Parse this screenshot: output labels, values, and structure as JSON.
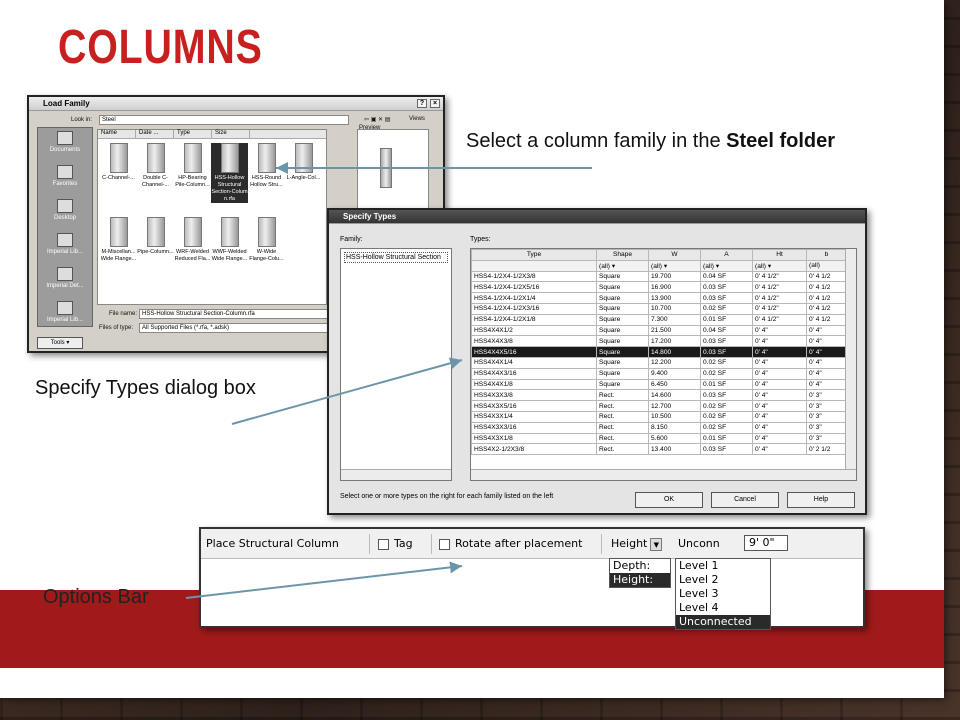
{
  "slide": {
    "title": "COLUMNS",
    "callout_steel_prefix": "Select a column family in the ",
    "callout_steel_bold": "Steel folder",
    "callout_specify": "Specify Types dialog box",
    "callout_options": "Options Bar",
    "accent_color": "#c8201e",
    "band_color": "#a11a1a"
  },
  "load_family": {
    "title": "Load Family",
    "look_in_label": "Look in:",
    "look_in_value": "Steel",
    "views_label": "Views",
    "preview_label": "Preview",
    "columns": [
      "Name",
      "Date ...",
      "Type",
      "Size"
    ],
    "places": [
      "Documents",
      "Favorites",
      "Desktop",
      "Imperial Lib...",
      "Imperial Det...",
      "Imperial Lib..."
    ],
    "files": [
      "C-Channel-...",
      "Double C-Channel-...",
      "HP-Bearing Pile-Column...",
      "HSS-Hollow Structural Section-Colum n.rfa",
      "HSS-Round Hollow Stru...",
      "L-Angle-Col...",
      "M-Miscellan... Wide Flange...",
      "Pipe-Column...",
      "WRF-Welded Reduced Fla...",
      "WWF-Welded Wide Flange...",
      "W-Wide Flange-Colu..."
    ],
    "file_name_label": "File name:",
    "file_name_value": "HSS-Hollow Structural Section-Column.rfa",
    "files_of_type_label": "Files of type:",
    "files_of_type_value": "All Supported Files (*.rfa, *.adsk)",
    "tools_label": "Tools"
  },
  "specify_types": {
    "title": "Specify Types",
    "family_label": "Family:",
    "types_label": "Types:",
    "family_item": "HSS-Hollow Structural Section",
    "headers": [
      "Type",
      "Shape",
      "W",
      "A",
      "Ht",
      "b"
    ],
    "filter_value": "(all)",
    "rows": [
      [
        "HSS4-1/2X4-1/2X3/8",
        "Square",
        "19.700",
        "0.04 SF",
        "0' 4 1/2\"",
        "0' 4 1/2"
      ],
      [
        "HSS4-1/2X4-1/2X5/16",
        "Square",
        "16.900",
        "0.03 SF",
        "0' 4 1/2\"",
        "0' 4 1/2"
      ],
      [
        "HSS4-1/2X4-1/2X1/4",
        "Square",
        "13.900",
        "0.03 SF",
        "0' 4 1/2\"",
        "0' 4 1/2"
      ],
      [
        "HSS4-1/2X4-1/2X3/16",
        "Square",
        "10.700",
        "0.02 SF",
        "0' 4 1/2\"",
        "0' 4 1/2"
      ],
      [
        "HSS4-1/2X4-1/2X1/8",
        "Square",
        "7.300",
        "0.01 SF",
        "0' 4 1/2\"",
        "0' 4 1/2"
      ],
      [
        "HSS4X4X1/2",
        "Square",
        "21.500",
        "0.04 SF",
        "0' 4\"",
        "0' 4\""
      ],
      [
        "HSS4X4X3/8",
        "Square",
        "17.200",
        "0.03 SF",
        "0' 4\"",
        "0' 4\""
      ],
      [
        "HSS4X4X5/16",
        "Square",
        "14.800",
        "0.03 SF",
        "0' 4\"",
        "0' 4\""
      ],
      [
        "HSS4X4X1/4",
        "Square",
        "12.200",
        "0.02 SF",
        "0' 4\"",
        "0' 4\""
      ],
      [
        "HSS4X4X3/16",
        "Square",
        "9.400",
        "0.02 SF",
        "0' 4\"",
        "0' 4\""
      ],
      [
        "HSS4X4X1/8",
        "Square",
        "6.450",
        "0.01 SF",
        "0' 4\"",
        "0' 4\""
      ],
      [
        "HSS4X3X3/8",
        "Rect.",
        "14.600",
        "0.03 SF",
        "0' 4\"",
        "0' 3\""
      ],
      [
        "HSS4X3X5/16",
        "Rect.",
        "12.700",
        "0.02 SF",
        "0' 4\"",
        "0' 3\""
      ],
      [
        "HSS4X3X1/4",
        "Rect.",
        "10.500",
        "0.02 SF",
        "0' 4\"",
        "0' 3\""
      ],
      [
        "HSS4X3X3/16",
        "Rect.",
        "8.150",
        "0.02 SF",
        "0' 4\"",
        "0' 3\""
      ],
      [
        "HSS4X3X1/8",
        "Rect.",
        "5.600",
        "0.01 SF",
        "0' 4\"",
        "0' 3\""
      ],
      [
        "HSS4X2-1/2X3/8",
        "Rect.",
        "13.400",
        "0.03 SF",
        "0' 4\"",
        "0' 2 1/2"
      ]
    ],
    "selected_row_index": 7,
    "hint": "Select one or more types on the right for each family listed on the left",
    "ok_label": "OK",
    "cancel_label": "Cancel",
    "help_label": "Help"
  },
  "options_bar": {
    "mode_label": "Place Structural Column",
    "tag_label": "Tag",
    "rotate_label": "Rotate after placement",
    "height_dropdown": "Height",
    "unconn_dropdown": "Unconn",
    "value": "9'  0\"",
    "depth_height_options": [
      "Depth:",
      "Height:"
    ],
    "selected_depth_height": "Height:",
    "level_options": [
      "Level 1",
      "Level 2",
      "Level 3",
      "Level 4",
      "Unconnected"
    ],
    "selected_level": "Unconnected"
  }
}
